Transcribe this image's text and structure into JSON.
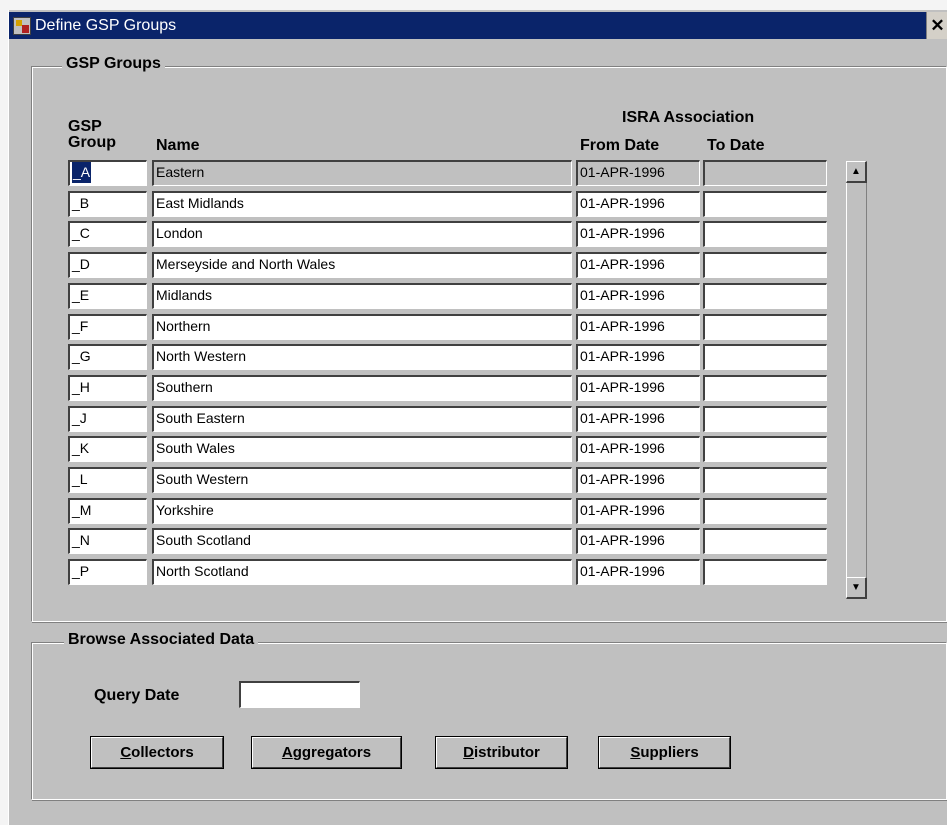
{
  "window": {
    "title": "Define GSP Groups",
    "close_glyph": "✕"
  },
  "gsp_groups": {
    "legend": "GSP Groups",
    "headers": {
      "gsp_line1": "GSP",
      "gsp_line2": "Group",
      "name": "Name",
      "isra": "ISRA Association",
      "from_date": "From Date",
      "to_date": "To Date"
    },
    "rows": [
      {
        "code": "_A",
        "name": "Eastern",
        "from": "01-APR-1996",
        "to": ""
      },
      {
        "code": "_B",
        "name": "East Midlands",
        "from": "01-APR-1996",
        "to": ""
      },
      {
        "code": "_C",
        "name": "London",
        "from": "01-APR-1996",
        "to": ""
      },
      {
        "code": "_D",
        "name": "Merseyside and North Wales",
        "from": "01-APR-1996",
        "to": ""
      },
      {
        "code": "_E",
        "name": "Midlands",
        "from": "01-APR-1996",
        "to": ""
      },
      {
        "code": "_F",
        "name": "Northern",
        "from": "01-APR-1996",
        "to": ""
      },
      {
        "code": "_G",
        "name": "North Western",
        "from": "01-APR-1996",
        "to": ""
      },
      {
        "code": "_H",
        "name": "Southern",
        "from": "01-APR-1996",
        "to": ""
      },
      {
        "code": "_J",
        "name": "South Eastern",
        "from": "01-APR-1996",
        "to": ""
      },
      {
        "code": "_K",
        "name": "South Wales",
        "from": "01-APR-1996",
        "to": ""
      },
      {
        "code": "_L",
        "name": "South Western",
        "from": "01-APR-1996",
        "to": ""
      },
      {
        "code": "_M",
        "name": "Yorkshire",
        "from": "01-APR-1996",
        "to": ""
      },
      {
        "code": "_N",
        "name": "South Scotland",
        "from": "01-APR-1996",
        "to": ""
      },
      {
        "code": "_P",
        "name": "North Scotland",
        "from": "01-APR-1996",
        "to": ""
      }
    ],
    "scroll_up_glyph": "▲",
    "scroll_down_glyph": "▼"
  },
  "browse": {
    "legend": "Browse Associated Data",
    "query_date_label": "Query Date",
    "query_date_value": "",
    "buttons": {
      "collectors": {
        "mnemonic": "C",
        "rest": "ollectors"
      },
      "aggregators": {
        "mnemonic": "A",
        "rest": "ggregators"
      },
      "distributor": {
        "mnemonic": "D",
        "rest": "istributor"
      },
      "suppliers": {
        "mnemonic": "S",
        "rest": "uppliers"
      }
    }
  },
  "colors": {
    "titlebar": "#0a246a",
    "window_bg": "#c0c0c0",
    "selection": "#0a246a"
  }
}
